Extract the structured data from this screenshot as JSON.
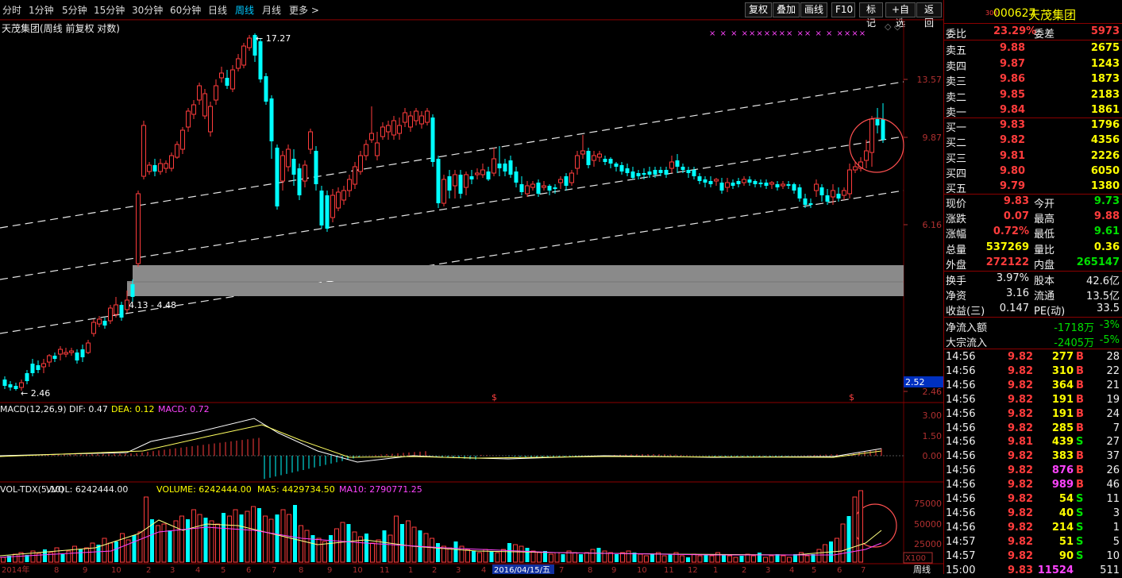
{
  "toolbar": {
    "periods": [
      "分时",
      "1分钟",
      "5分钟",
      "15分钟",
      "30分钟",
      "60分钟",
      "日线",
      "周线",
      "月线",
      "更多"
    ],
    "active_period": "周线",
    "buttons": [
      "复权",
      "叠加",
      "画线",
      "F10",
      "标记",
      "+自选",
      "返回"
    ]
  },
  "chart": {
    "title": "天茂集团(周线 前复权 对数)",
    "high_label": "17.27",
    "low_label": "2.46",
    "zone_label": "4.13 - 4.48",
    "price_ticks": [
      "13.57",
      "9.87",
      "6.16",
      "2.46"
    ],
    "current_badge": "2.52",
    "marker_rows": [
      "× × ×  ×××××××  ×× × × ××××"
    ],
    "date_tag": "2016/04/15/五",
    "x_labels": [
      "2014年",
      "8",
      "9",
      "10",
      "2",
      "3",
      "4",
      "5",
      "6",
      "7",
      "8",
      "9",
      "10",
      "11",
      "1",
      "2",
      "3",
      "4",
      "5",
      "6",
      "7",
      "8",
      "9",
      "10",
      "11",
      "12",
      "1",
      "2",
      "3",
      "4",
      "5",
      "6",
      "7"
    ],
    "period_tab": "周线"
  },
  "macd": {
    "label": "MACD(12,26,9)",
    "dif": "DIF: 0.47",
    "dea": "DEA: 0.12",
    "macd": "MACD: 0.72",
    "ticks": [
      "3.00",
      "1.50",
      "0.00"
    ]
  },
  "volume": {
    "label": "VOL-TDX(5,10)",
    "vvol": "VVOL: 6242444.00",
    "volume": "VOLUME: 6242444.00",
    "ma5": "MA5: 4429734.50",
    "ma10": "MA10: 2790771.25",
    "ticks": [
      "75000",
      "50000",
      "25000"
    ],
    "unit": "X100"
  },
  "quote": {
    "code_prefix": "300",
    "code": "000627",
    "name": "天茂集团",
    "weibi_label": "委比",
    "weibi": "23.29%",
    "weicha_label": "委差",
    "weicha": "5973",
    "asks": [
      {
        "label": "卖五",
        "price": "9.88",
        "vol": "2675"
      },
      {
        "label": "卖四",
        "price": "9.87",
        "vol": "1243"
      },
      {
        "label": "卖三",
        "price": "9.86",
        "vol": "1873"
      },
      {
        "label": "卖二",
        "price": "9.85",
        "vol": "2183"
      },
      {
        "label": "卖一",
        "price": "9.84",
        "vol": "1861"
      }
    ],
    "bids": [
      {
        "label": "买一",
        "price": "9.83",
        "vol": "1796"
      },
      {
        "label": "买二",
        "price": "9.82",
        "vol": "4356"
      },
      {
        "label": "买三",
        "price": "9.81",
        "vol": "2226"
      },
      {
        "label": "买四",
        "price": "9.80",
        "vol": "6050"
      },
      {
        "label": "买五",
        "price": "9.79",
        "vol": "1380"
      }
    ],
    "stats": [
      {
        "l1": "现价",
        "v1": "9.83",
        "c1": "red",
        "l2": "今开",
        "v2": "9.73",
        "c2": "grn"
      },
      {
        "l1": "涨跌",
        "v1": "0.07",
        "c1": "red",
        "l2": "最高",
        "v2": "9.88",
        "c2": "red"
      },
      {
        "l1": "涨幅",
        "v1": "0.72%",
        "c1": "red",
        "l2": "最低",
        "v2": "9.61",
        "c2": "grn"
      },
      {
        "l1": "总量",
        "v1": "537269",
        "c1": "yel",
        "l2": "量比",
        "v2": "0.36",
        "c2": "yel"
      },
      {
        "l1": "外盘",
        "v1": "272122",
        "c1": "red",
        "l2": "内盘",
        "v2": "265147",
        "c2": "grn"
      }
    ],
    "stats2": [
      {
        "l1": "换手",
        "v1": "3.97%",
        "l2": "股本",
        "v2": "42.6亿"
      },
      {
        "l1": "净资",
        "v1": "3.16",
        "l2": "流通",
        "v2": "13.5亿"
      },
      {
        "l1": "收益(三)",
        "v1": "0.147",
        "l2": "PE(动)",
        "v2": "33.5"
      }
    ],
    "flows": [
      {
        "label": "净流入额",
        "value": "-1718万",
        "pct": "-3%"
      },
      {
        "label": "大宗流入",
        "value": "-2405万",
        "pct": "-5%"
      }
    ],
    "ticks": [
      {
        "t": "14:56",
        "p": "9.82",
        "v": "277",
        "s": "B",
        "n": "28",
        "pc": "red",
        "vc": "yel",
        "sc": "red"
      },
      {
        "t": "14:56",
        "p": "9.82",
        "v": "310",
        "s": "B",
        "n": "22",
        "pc": "red",
        "vc": "yel",
        "sc": "red"
      },
      {
        "t": "14:56",
        "p": "9.82",
        "v": "364",
        "s": "B",
        "n": "21",
        "pc": "red",
        "vc": "yel",
        "sc": "red"
      },
      {
        "t": "14:56",
        "p": "9.82",
        "v": "191",
        "s": "B",
        "n": "19",
        "pc": "red",
        "vc": "yel",
        "sc": "red"
      },
      {
        "t": "14:56",
        "p": "9.82",
        "v": "191",
        "s": "B",
        "n": "24",
        "pc": "red",
        "vc": "yel",
        "sc": "red"
      },
      {
        "t": "14:56",
        "p": "9.82",
        "v": "285",
        "s": "B",
        "n": "7",
        "pc": "red",
        "vc": "yel",
        "sc": "red"
      },
      {
        "t": "14:56",
        "p": "9.81",
        "v": "439",
        "s": "S",
        "n": "27",
        "pc": "red",
        "vc": "yel",
        "sc": "grn"
      },
      {
        "t": "14:56",
        "p": "9.82",
        "v": "383",
        "s": "B",
        "n": "37",
        "pc": "red",
        "vc": "yel",
        "sc": "red"
      },
      {
        "t": "14:56",
        "p": "9.82",
        "v": "876",
        "s": "B",
        "n": "26",
        "pc": "red",
        "vc": "mag",
        "sc": "red"
      },
      {
        "t": "14:56",
        "p": "9.82",
        "v": "989",
        "s": "B",
        "n": "46",
        "pc": "red",
        "vc": "mag",
        "sc": "red"
      },
      {
        "t": "14:56",
        "p": "9.82",
        "v": "54",
        "s": "S",
        "n": "11",
        "pc": "red",
        "vc": "yel",
        "sc": "grn"
      },
      {
        "t": "14:56",
        "p": "9.82",
        "v": "40",
        "s": "S",
        "n": "3",
        "pc": "red",
        "vc": "yel",
        "sc": "grn"
      },
      {
        "t": "14:56",
        "p": "9.82",
        "v": "214",
        "s": "S",
        "n": "1",
        "pc": "red",
        "vc": "yel",
        "sc": "grn"
      },
      {
        "t": "14:57",
        "p": "9.82",
        "v": "51",
        "s": "S",
        "n": "5",
        "pc": "red",
        "vc": "yel",
        "sc": "grn"
      },
      {
        "t": "14:57",
        "p": "9.82",
        "v": "90",
        "s": "S",
        "n": "10",
        "pc": "red",
        "vc": "yel",
        "sc": "grn"
      },
      {
        "t": "15:00",
        "p": "9.83",
        "v": "11524",
        "s": "",
        "n": "511",
        "pc": "red",
        "vc": "mag",
        "sc": "wht"
      }
    ]
  },
  "colors": {
    "up": "#ff3c3c",
    "down": "#00ffff",
    "bg": "#000000",
    "ma_yellow": "#ffff80",
    "ma_magenta": "#ff44ff"
  }
}
